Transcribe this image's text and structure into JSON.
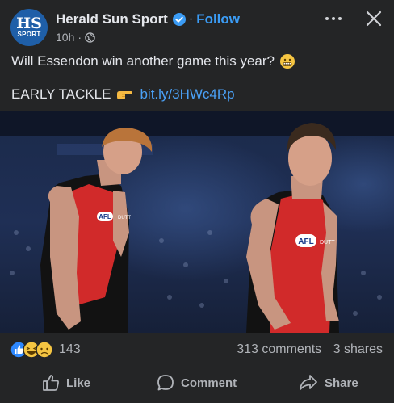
{
  "post": {
    "page_name": "Herald Sun Sport",
    "avatar_line1": "HS",
    "avatar_line2": "SPORT",
    "follow_label": "Follow",
    "dot_sep": "·",
    "time": "10h",
    "text_line1": "Will Essendon win another game this year?",
    "text_line2_prefix": "EARLY TACKLE",
    "link": "bit.ly/3HWc4Rp",
    "jersey_logo": "AFL",
    "jersey_sponsor": "DUTT"
  },
  "engagement": {
    "reaction_count": "143",
    "comments": "313 comments",
    "shares": "3 shares"
  },
  "actions": {
    "like": "Like",
    "comment": "Comment",
    "share": "Share"
  },
  "colors": {
    "background": "#242526",
    "accent": "#3b9cf5",
    "jersey_red": "#d12a2a",
    "jersey_black": "#111111"
  },
  "icons": [
    "verified-badge-icon",
    "globe-icon",
    "more-options-icon",
    "close-icon",
    "grimace-emoji-icon",
    "pointing-hand-emoji-icon",
    "like-reaction-icon",
    "haha-reaction-icon",
    "sad-reaction-icon",
    "thumbs-up-icon",
    "comment-bubble-icon",
    "share-arrow-icon"
  ]
}
